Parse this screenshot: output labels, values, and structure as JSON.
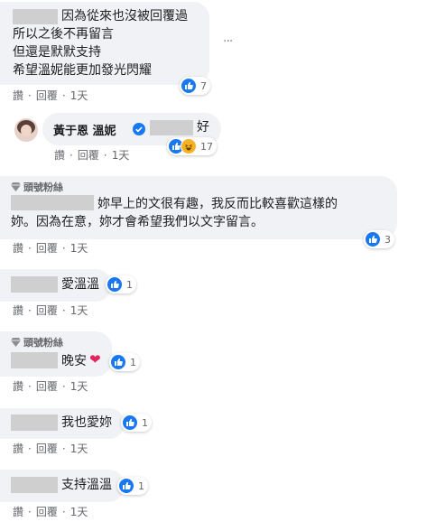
{
  "comments": [
    {
      "lines": [
        "因為從來也沒被回覆過",
        "所以之後不再留言",
        "但還是默默支持",
        "希望溫妮能更加發光閃耀"
      ],
      "reaction_count": "7",
      "actions": {
        "like": "讚",
        "reply": "回覆",
        "time": "1天"
      }
    },
    {
      "author": "黃于恩 溫妮",
      "text": "好",
      "reaction_count": "17",
      "actions": {
        "like": "讚",
        "reply": "回覆",
        "time": "1天"
      }
    },
    {
      "badge": "頭號粉絲",
      "lines": [
        "妳早上的文很有趣，我反而比較喜歡這樣的",
        "妳。因為在意，妳才會希望我們以文字留言。"
      ],
      "reaction_count": "3",
      "actions": {
        "like": "讚",
        "reply": "回覆",
        "time": "1天"
      }
    },
    {
      "text": "愛溫溫",
      "reaction_count": "1",
      "actions": {
        "like": "讚",
        "reply": "回覆",
        "time": "1天"
      }
    },
    {
      "badge": "頭號粉絲",
      "text": "晚安",
      "reaction_count": "1",
      "actions": {
        "like": "讚",
        "reply": "回覆",
        "time": "1天"
      }
    },
    {
      "text": "我也愛妳",
      "reaction_count": "1",
      "actions": {
        "like": "讚",
        "reply": "回覆",
        "time": "1天"
      }
    },
    {
      "text": "支持溫溫",
      "reaction_count": "1",
      "actions": {
        "like": "讚",
        "reply": "回覆",
        "time": "1天"
      }
    }
  ],
  "more_options_glyph": "···",
  "colors": {
    "like_blue": "#1877f2",
    "bubble": "#f0f2f5",
    "meta": "#65676b",
    "heart": "#e0245e",
    "haha": "#f7b125"
  }
}
